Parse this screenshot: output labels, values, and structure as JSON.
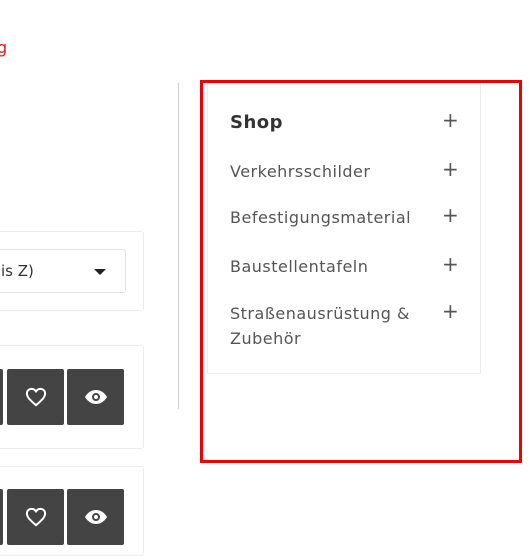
{
  "header": {
    "red_text_fragment": "g"
  },
  "sort": {
    "selected_value_fragment": "is Z)"
  },
  "sidebar": {
    "heading": "Shop",
    "items": [
      {
        "label": "Verkehrsschilder"
      },
      {
        "label": "Befestigungsmaterial"
      },
      {
        "label": "Baustellentafeln"
      },
      {
        "label": "Straßenausrüstung & Zubehör"
      }
    ],
    "expand_symbol": "+"
  },
  "colors": {
    "accent_red": "#e21b1b",
    "highlight_box": "#ee0000",
    "action_button_bg": "#444444"
  },
  "icons": [
    "heart-icon",
    "eye-icon",
    "chevron-down-icon",
    "plus-icon"
  ]
}
